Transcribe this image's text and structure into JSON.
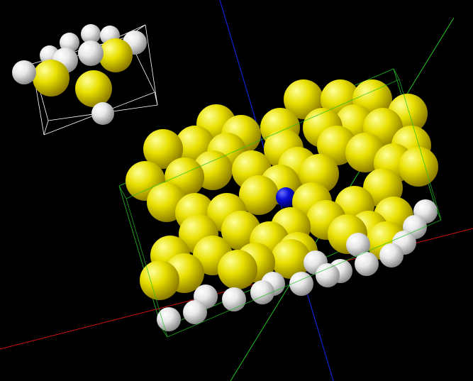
{
  "scene": {
    "background": "#000000",
    "atom_colors": {
      "yellow": "#e8e000",
      "white": "#e8e8e8",
      "blue": "#0a10d8"
    },
    "axis_colors": {
      "x": "#d01010",
      "y": "#20c020",
      "z": "#1020d0"
    },
    "cell_edge_color": "#ffffff"
  }
}
